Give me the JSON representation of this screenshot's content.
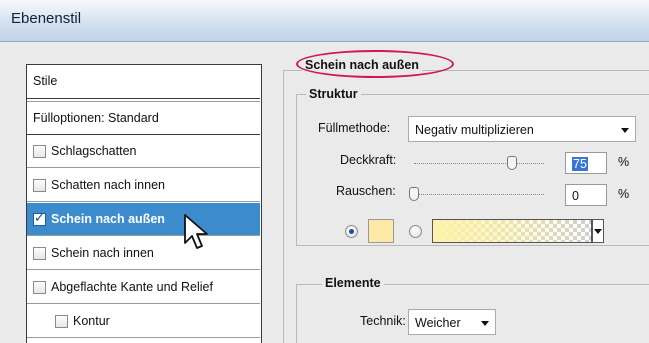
{
  "window": {
    "title": "Ebenenstil"
  },
  "styles_panel": {
    "header": "Stile",
    "fill_options": "Fülloptionen: Standard",
    "items": [
      {
        "label": "Schlagschatten",
        "checked": false,
        "selected": false
      },
      {
        "label": "Schatten nach innen",
        "checked": false,
        "selected": false
      },
      {
        "label": "Schein nach außen",
        "checked": true,
        "selected": true
      },
      {
        "label": "Schein nach innen",
        "checked": false,
        "selected": false
      },
      {
        "label": "Abgeflachte Kante und Relief",
        "checked": false,
        "selected": false
      },
      {
        "label": "Kontur",
        "checked": false,
        "selected": false
      }
    ]
  },
  "outer_glow": {
    "section_title": "Schein nach außen",
    "structure": {
      "title": "Struktur",
      "blend_mode_label": "Füllmethode:",
      "blend_mode_value": "Negativ multiplizieren",
      "opacity_label": "Deckkraft:",
      "opacity_value": "75",
      "opacity_unit": "%",
      "opacity_level": 0.75,
      "noise_label": "Rauschen:",
      "noise_value": "0",
      "noise_unit": "%",
      "noise_level": 0,
      "solid_color": "#fde9a6",
      "gradient_color": "#fdf3a8"
    },
    "elements": {
      "title": "Elemente",
      "technique_label": "Technik:",
      "technique_value": "Weicher"
    }
  },
  "colors": {
    "selection": "#3c8ccd",
    "highlight_ellipse": "#d4145a"
  }
}
